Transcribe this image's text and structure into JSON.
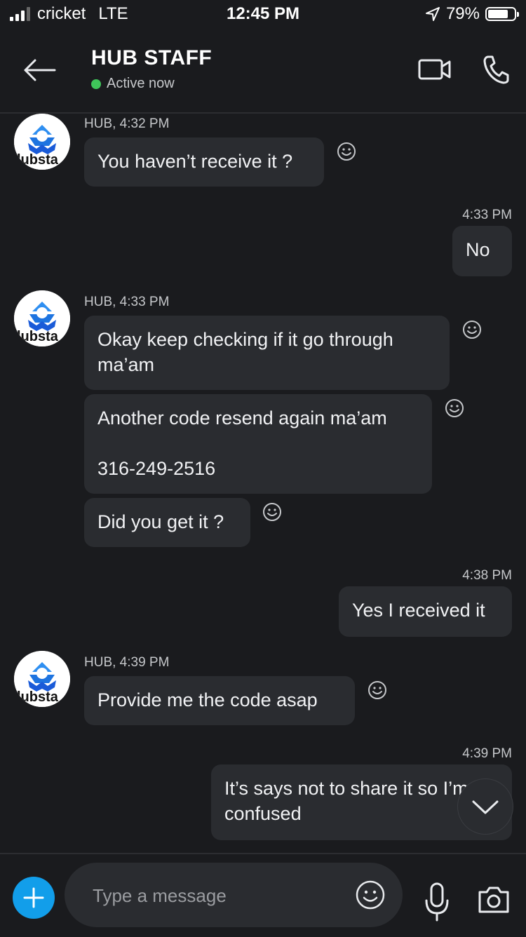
{
  "status_bar": {
    "carrier": "cricket",
    "network": "LTE",
    "time": "12:45 PM",
    "battery_percent": "79%",
    "battery_level": 0.79,
    "signal_bars": 3
  },
  "header": {
    "title": "HUB STAFF",
    "presence": "Active now",
    "presence_color": "#3fc55a",
    "icons": [
      "back-arrow-icon",
      "video-camera-icon",
      "phone-icon"
    ]
  },
  "messages": [
    {
      "direction": "in",
      "meta": "HUB, 4:32 PM",
      "text": "You haven’t receive it ?"
    },
    {
      "direction": "out",
      "meta": "4:33 PM",
      "text": "No"
    },
    {
      "direction": "in",
      "meta": "HUB, 4:33 PM",
      "text": "Okay keep checking if it go through\nma’am"
    },
    {
      "direction": "in",
      "meta": "",
      "text": "Another code resend again ma’am\n\n316-249-2516"
    },
    {
      "direction": "in",
      "meta": "",
      "text": "Did you get it ?"
    },
    {
      "direction": "out",
      "meta": "4:38 PM",
      "text": "Yes I received it"
    },
    {
      "direction": "in",
      "meta": "HUB, 4:39 PM",
      "text": "Provide me the code asap"
    },
    {
      "direction": "out",
      "meta": "4:39 PM",
      "text": "It’s says not to share it so I’m\nconfused"
    }
  ],
  "composer": {
    "placeholder": "Type a message",
    "accent": "#129eea"
  }
}
